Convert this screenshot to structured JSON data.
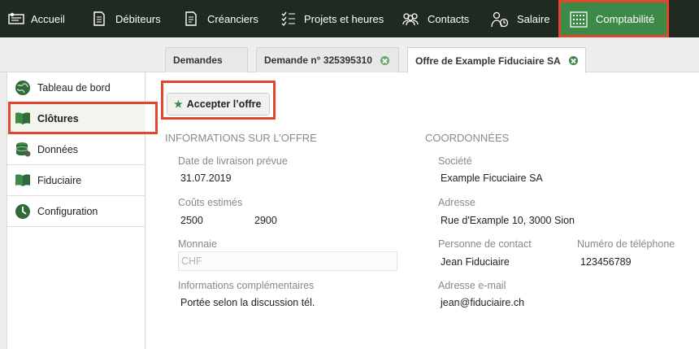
{
  "nav": {
    "items": [
      {
        "label": "Accueil"
      },
      {
        "label": "Débiteurs"
      },
      {
        "label": "Créanciers"
      },
      {
        "label": "Projets et heures"
      },
      {
        "label": "Contacts"
      },
      {
        "label": "Salaire"
      },
      {
        "label": "Comptabilité"
      }
    ]
  },
  "tabs": [
    {
      "label": "Demandes"
    },
    {
      "label": "Demande n° 325395310"
    },
    {
      "label": "Offre de Example Fiduciaire SA"
    }
  ],
  "sidebar": {
    "items": [
      {
        "label": "Tableau de bord"
      },
      {
        "label": "Clôtures"
      },
      {
        "label": "Données"
      },
      {
        "label": "Fiduciaire"
      },
      {
        "label": "Configuration"
      }
    ]
  },
  "actions": {
    "accept_label": "Accepter l’offre"
  },
  "offer_info": {
    "title": "INFORMATIONS SUR L’OFFRE",
    "delivery_label": "Date de livraison prévue",
    "delivery_value": "31.07.2019",
    "cost_label": "Coûts estimés",
    "cost_min": "2500",
    "cost_max": "2900",
    "currency_label": "Monnaie",
    "currency_value": "CHF",
    "extra_label": "Informations complémentaires",
    "extra_value": "Portée selon la discussion tél."
  },
  "contact_info": {
    "title": "COORDONNÉES",
    "company_label": "Société",
    "company_value": "Example Ficuciaire SA",
    "address_label": "Adresse",
    "address_value": "Rue d'Example 10, 3000 Sion",
    "person_label": "Personne de contact",
    "person_value": "Jean Fiduciaire",
    "phone_label": "Numéro de téléphone",
    "phone_value": "123456789",
    "email_label": "Adresse e-mail",
    "email_value": "jean@fiduciaire.ch"
  },
  "colors": {
    "nav_bg": "#1f2a20",
    "accent_green": "#3d8a48",
    "highlight_red": "#e2462f"
  }
}
